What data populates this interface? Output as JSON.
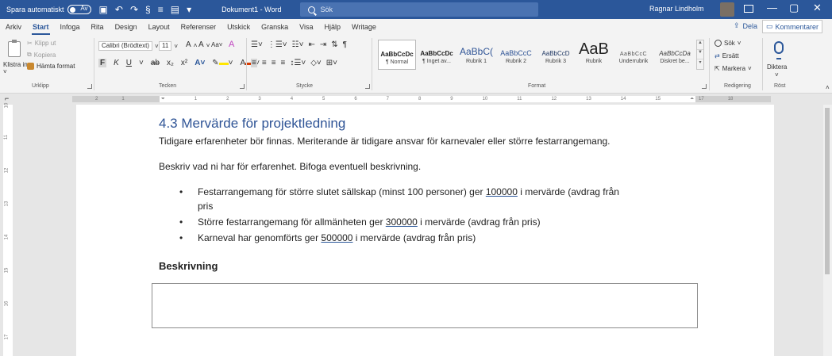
{
  "titlebar": {
    "autosave_label": "Spara automatiskt",
    "autosave_state": "Av",
    "doc_name": "Dokument1 - Word",
    "search_placeholder": "Sök",
    "user_name": "Ragnar Lindholm",
    "window_controls": [
      "—",
      "▢",
      "✕"
    ]
  },
  "tabs": [
    "Arkiv",
    "Start",
    "Infoga",
    "Rita",
    "Design",
    "Layout",
    "Referenser",
    "Utskick",
    "Granska",
    "Visa",
    "Hjälp",
    "Writage"
  ],
  "active_tab": "Start",
  "share_label": "Dela",
  "comments_label": "Kommentarer",
  "ribbon": {
    "clipboard": {
      "paste_label": "Klistra in ˅",
      "cut": "Klipp ut",
      "copy": "Kopiera",
      "format_painter": "Hämta format",
      "group_label": "Urklipp"
    },
    "font": {
      "font_name": "Calibri (Brödtext)",
      "font_size": "11",
      "group_label": "Tecken",
      "highlight_color": "#ffe600",
      "font_color": "#d83b01"
    },
    "paragraph": {
      "group_label": "Stycke"
    },
    "styles": {
      "group_label": "Format",
      "items": [
        {
          "preview": "AaBbCcDc",
          "name": "¶ Normal"
        },
        {
          "preview": "AaBbCcDc",
          "name": "¶ Inget av..."
        },
        {
          "preview": "AaBbC(",
          "name": "Rubrik 1"
        },
        {
          "preview": "AaBbCcC",
          "name": "Rubrik 2"
        },
        {
          "preview": "AaBbCcD",
          "name": "Rubrik 3"
        },
        {
          "preview": "AaB",
          "name": "Rubrik"
        },
        {
          "preview": "AaBbCcC",
          "name": "Underrubrik"
        },
        {
          "preview": "AaBbCcDa",
          "name": "Diskret be..."
        }
      ]
    },
    "editing": {
      "group_label": "Redigering",
      "find": "Sök",
      "replace": "Ersätt",
      "select": "Markera"
    },
    "voice": {
      "group_label": "Röst",
      "dictate": "Diktera"
    }
  },
  "ruler": {
    "left_numbers": [
      "2",
      "1"
    ],
    "numbers": [
      "1",
      "2",
      "3",
      "4",
      "5",
      "6",
      "7",
      "8",
      "9",
      "10",
      "11",
      "12",
      "13",
      "14",
      "15"
    ],
    "right_numbers": [
      "17",
      "18"
    ],
    "vertical_numbers": [
      "10",
      "11",
      "12",
      "13",
      "14",
      "15",
      "16",
      "17"
    ]
  },
  "document": {
    "heading": "4.3 Mervärde för projektledning",
    "para1": "Tidigare erfarenheter bör finnas. Meriterande är tidigare ansvar för karnevaler eller större festarrangemang.",
    "para2": "Beskriv vad ni har för erfarenhet. Bifoga eventuell beskrivning.",
    "bullets": [
      {
        "pre": "Festarrangemang för större slutet sällskap (minst 100 personer) ger ",
        "value": "100000",
        "post": " i mervärde (avdrag från",
        "cont": "pris"
      },
      {
        "pre": "Större festarrangemang för allmänheten ger ",
        "value": "300000",
        "post": " i mervärde (avdrag från pris)"
      },
      {
        "pre": "Karneval har genomförts ger ",
        "value": "500000",
        "post": " i mervärde (avdrag från pris)"
      }
    ],
    "subheading": "Beskrivning"
  }
}
